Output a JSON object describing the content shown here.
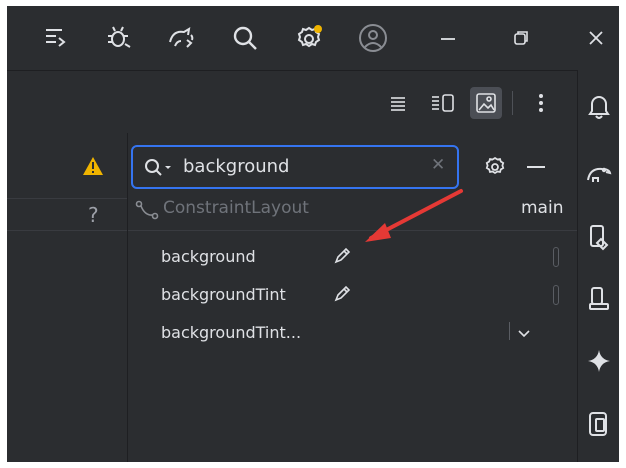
{
  "titlebar": {
    "icons": [
      "commit-icon",
      "debug-icon",
      "sync-icon",
      "search-icon",
      "settings-icon",
      "profile-icon",
      "minimize-icon",
      "restore-icon",
      "close-icon"
    ],
    "settings_badge_color": "#f0b400"
  },
  "toolbar": {
    "view_modes": [
      "code-view-icon",
      "split-view-icon",
      "design-view-icon"
    ],
    "active_mode": "design-view-icon"
  },
  "right_strip": {
    "icons": [
      "notifications-icon",
      "gradle-icon",
      "device-manager-icon",
      "running-devices-icon",
      "gemini-icon",
      "device-mirror-icon"
    ]
  },
  "left_pane": {
    "help": "?"
  },
  "attributes": {
    "search": {
      "value": "background"
    },
    "component": "ConstraintLayout",
    "layout_name": "main",
    "rows": [
      {
        "name": "background"
      },
      {
        "name": "backgroundTint"
      },
      {
        "name": "backgroundTint..."
      }
    ]
  },
  "colors": {
    "accent": "#3574f0",
    "warning": "#f0b400",
    "annotation_arrow": "#e53935"
  }
}
